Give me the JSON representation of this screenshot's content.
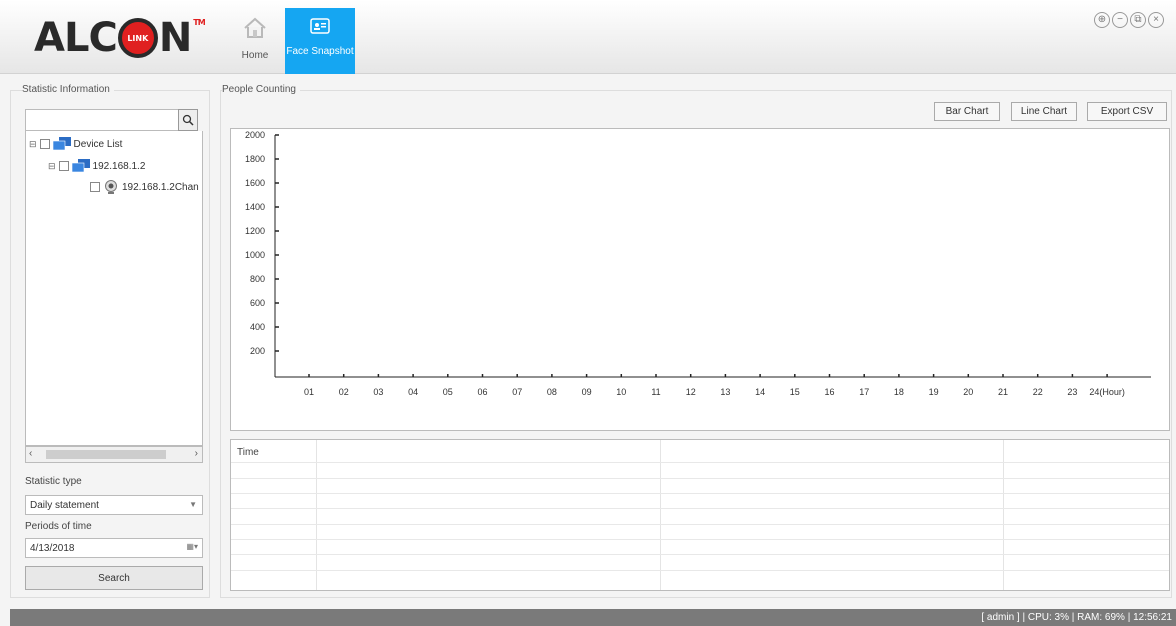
{
  "header": {
    "logo_text_left": "ALC",
    "logo_badge": "LINK",
    "logo_text_right": "N",
    "logo_tm": "TM",
    "nav": [
      {
        "label": "Home",
        "icon": "home-icon",
        "active": false
      },
      {
        "label": "Face Snapshot",
        "icon": "face-snapshot-icon",
        "active": true
      }
    ],
    "window_controls": [
      "lock-icon",
      "minimize-icon",
      "restore-icon",
      "close-icon"
    ],
    "active_color": "#15a6f2"
  },
  "left_panel": {
    "title": "Statistic Information",
    "search_value": "",
    "tree": {
      "root": "Device List",
      "device": "192.168.1.2",
      "channel": "192.168.1.2Chan"
    },
    "statistic_type_label": "Statistic type",
    "statistic_type_value": "Daily statement",
    "period_label": "Periods of time",
    "date_value": "4/13/2018",
    "search_button": "Search"
  },
  "right_panel": {
    "title": "People Counting",
    "buttons": {
      "bar_chart": "Bar Chart",
      "line_chart": "Line Chart",
      "export_csv": "Export CSV"
    },
    "table_header": "Time"
  },
  "chart_data": {
    "type": "bar",
    "title": "",
    "xlabel": "",
    "ylabel": "",
    "categories": [
      "01",
      "02",
      "03",
      "04",
      "05",
      "06",
      "07",
      "08",
      "09",
      "10",
      "11",
      "12",
      "13",
      "14",
      "15",
      "16",
      "17",
      "18",
      "19",
      "20",
      "21",
      "22",
      "23",
      "24(Hour)"
    ],
    "values": [
      0,
      0,
      0,
      0,
      0,
      0,
      0,
      0,
      0,
      0,
      0,
      0,
      0,
      0,
      0,
      0,
      0,
      0,
      0,
      0,
      0,
      0,
      0,
      0
    ],
    "yticks": [
      "2000",
      "1800",
      "1600",
      "1400",
      "1200",
      "1000",
      "800",
      "600",
      "400",
      "200"
    ],
    "ylim": [
      0,
      2000
    ],
    "grid": false
  },
  "statusbar": {
    "text": "[ admin ] | CPU: 3% | RAM: 69% | 12:56:21"
  }
}
